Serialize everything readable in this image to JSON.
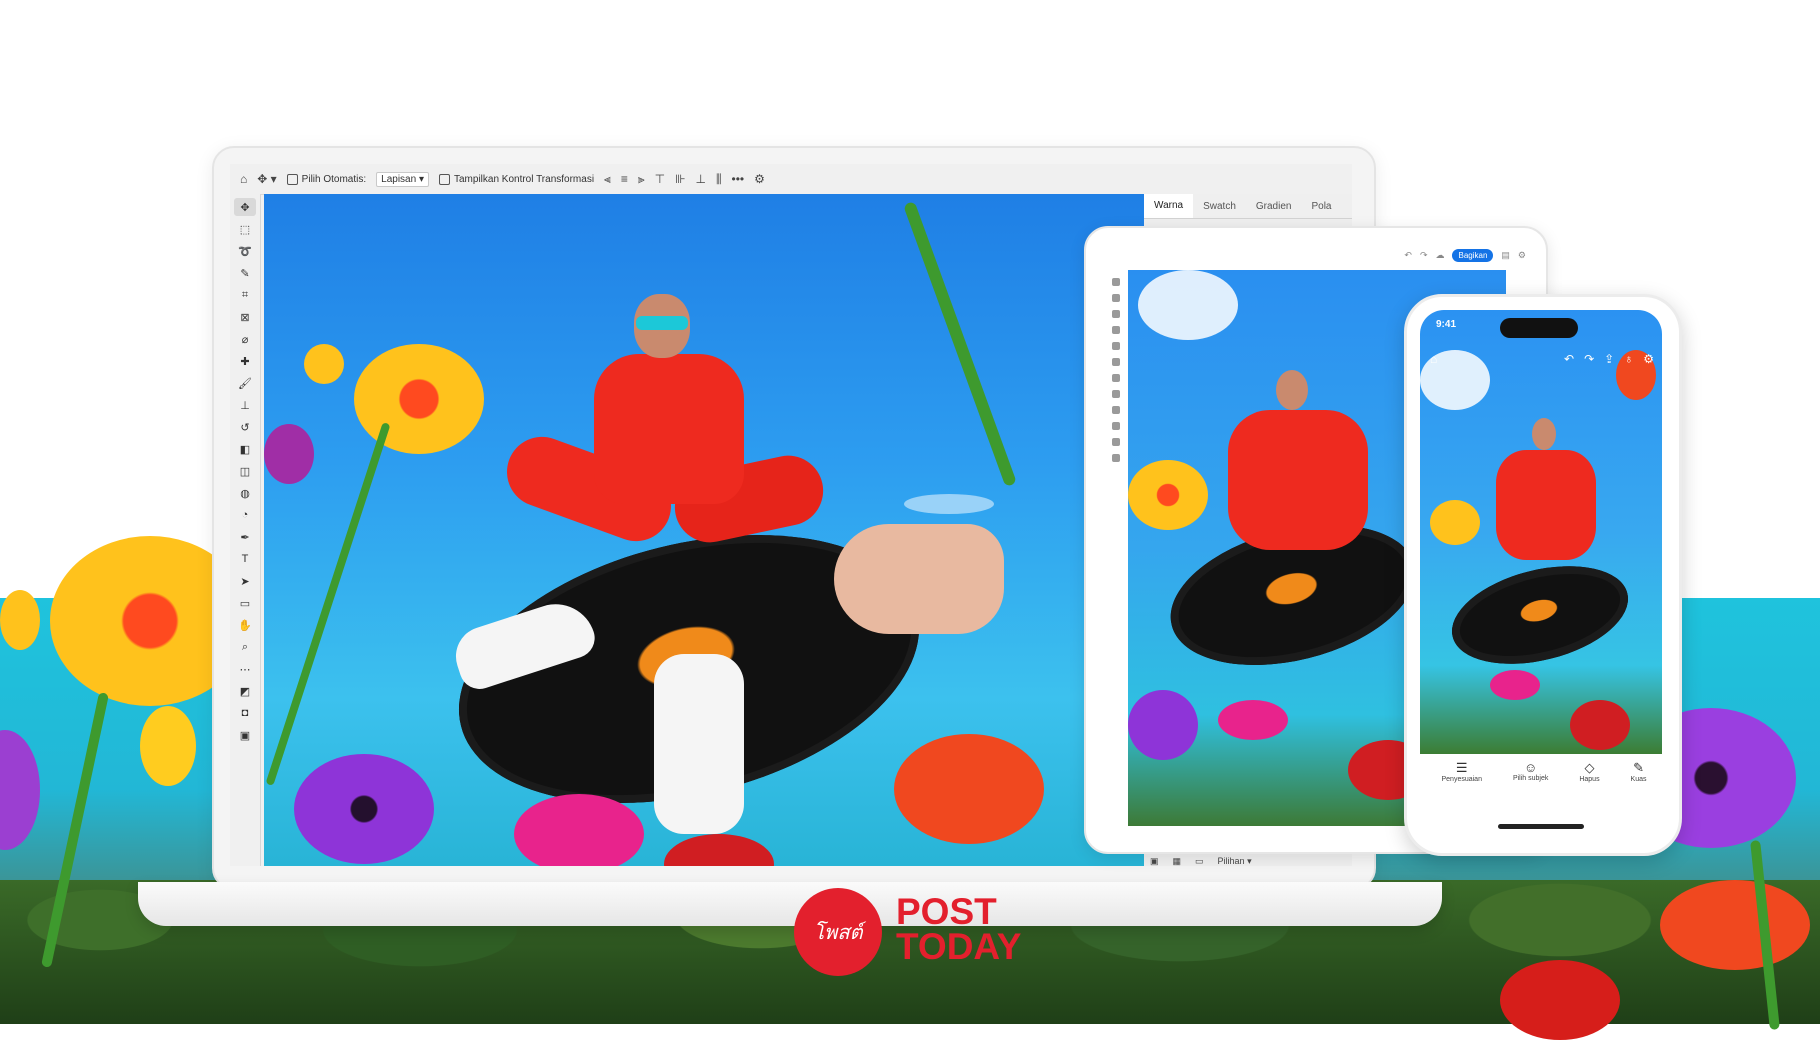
{
  "photoshop": {
    "options_bar": {
      "auto_select_label": "Pilih Otomatis:",
      "layer_select_value": "Lapisan",
      "transform_controls_label": "Tampilkan Kontrol Transformasi",
      "more_label": "•••"
    },
    "panel_tabs": [
      "Warna",
      "Swatch",
      "Gradien",
      "Pola"
    ]
  },
  "tablet": {
    "share_label": "Bagikan",
    "bottom_zoom_value": "Pilihan"
  },
  "phone": {
    "status_time": "9:41",
    "actions": [
      {
        "label": "Penyesuaian",
        "icon": "sliders-icon"
      },
      {
        "label": "Pilih subjek",
        "icon": "person-select-icon"
      },
      {
        "label": "Hapus",
        "icon": "eraser-icon"
      },
      {
        "label": "Kuas",
        "icon": "brush-icon"
      }
    ]
  },
  "logo": {
    "circle_text": "โพสต์",
    "line1": "POST",
    "line2": "TODAY",
    "brand_color": "#e3202d"
  }
}
